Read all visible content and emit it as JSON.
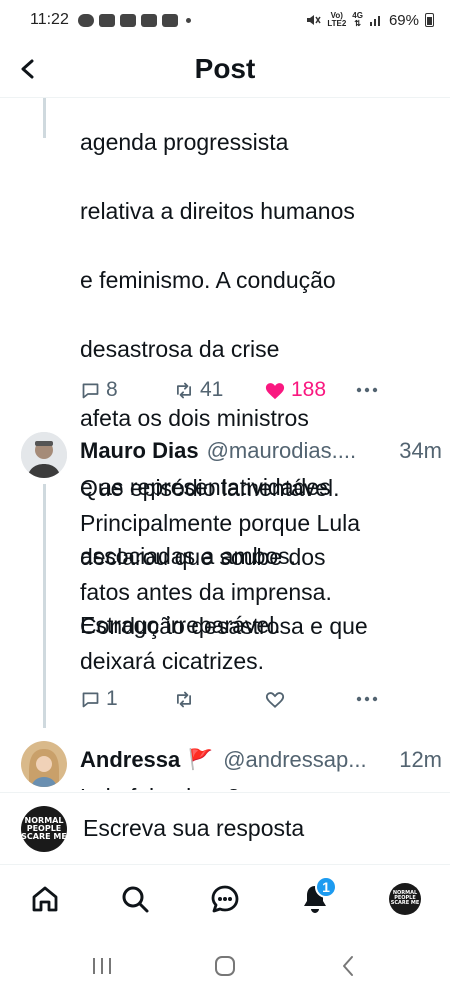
{
  "status_bar": {
    "time": "11:22",
    "network_top": "Vo)",
    "network_bottom": "LTE2",
    "net_gen_top": "4G",
    "battery_pct": "69%"
  },
  "header": {
    "title": "Post"
  },
  "main_tweet": {
    "text_lines": [
      "agenda progressista",
      "relativa a direitos humanos",
      "e feminismo. A condução",
      "desastrosa da crise",
      "afeta os dois ministros",
      "e as representatividades",
      "associadas a ambos.",
      "Estrago irreparável."
    ],
    "replies": "8",
    "retweets": "41",
    "likes": "188"
  },
  "reply_1": {
    "name": "Mauro Dias",
    "handle": "@maurodias....",
    "time": "34m",
    "text": "Que episódio lamentável.\nPrincipalmente porque Lula\ndeclarou que soube dos\nfatos antes da imprensa.\nCondução desastrosa e que\ndeixará cicatrizes.",
    "replies": "1"
  },
  "reply_2": {
    "name": "Andressa",
    "flag": "🚩",
    "handle": "@andressap...",
    "time": "12m",
    "text_partial": "Lula falou isso?"
  },
  "composer": {
    "placeholder": "Escreva sua resposta",
    "avatar_text": "NORMAL PEOPLE SCARE ME"
  },
  "bottom_nav": {
    "notifications_badge": "1",
    "avatar_text": "NORMAL PEOPLE SCARE ME"
  },
  "colors": {
    "accent": "#1d9bf0",
    "like": "#f91880",
    "muted": "#536471",
    "text": "#0f1419"
  }
}
